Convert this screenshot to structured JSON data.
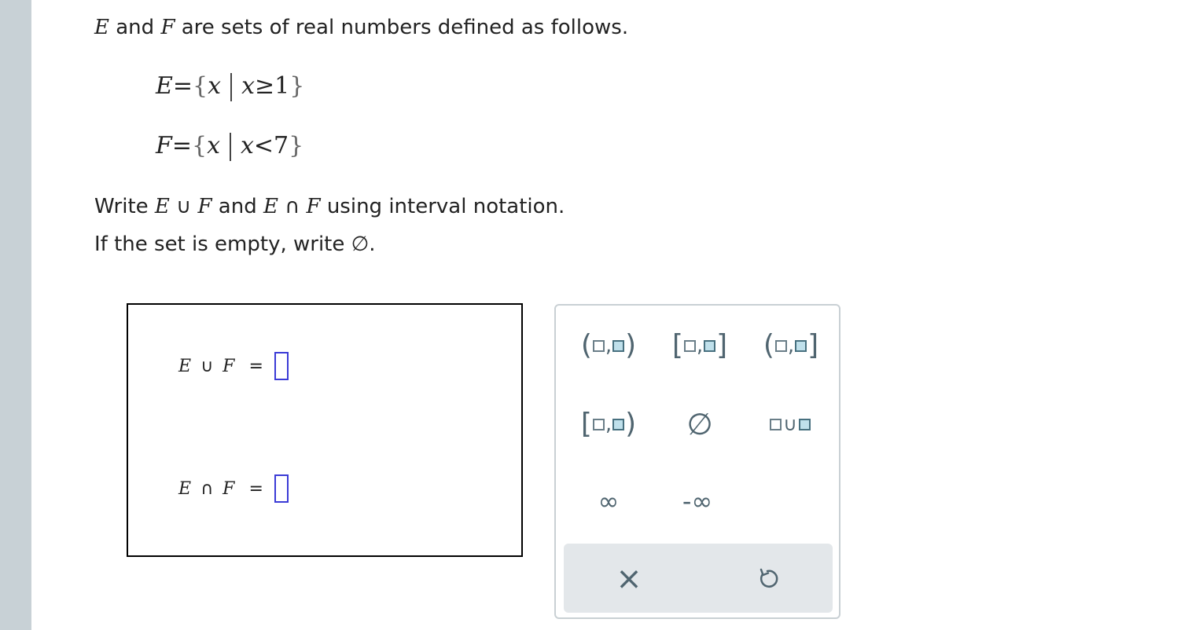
{
  "question": {
    "set_e": "E",
    "set_f": "F",
    "intro_and": "and",
    "intro_rest": "are sets of real numbers defined as follows.",
    "def_e": {
      "lhs": "E",
      "var": "x",
      "cond_var": "x",
      "cond_op": "≥",
      "cond_val": "1"
    },
    "def_f": {
      "lhs": "F",
      "var": "x",
      "cond_var": "x",
      "cond_op": "<",
      "cond_val": "7"
    },
    "instr_write": "Write",
    "union_symbol": "∪",
    "intersection_symbol": "∩",
    "instr_and": "and",
    "instr_rest": "using interval notation.",
    "empty_line": "If the set is empty, write",
    "empty_symbol": "∅",
    "period": "."
  },
  "answers": {
    "union_lhs_e": "E",
    "union_op": "∪",
    "union_lhs_f": "F",
    "inter_lhs_e": "E",
    "inter_op": "∩",
    "inter_lhs_f": "F",
    "equals": "="
  },
  "keypad": {
    "open_open_left": "(",
    "open_open_right": ")",
    "closed_closed_left": "[",
    "closed_closed_right": "]",
    "open_closed_left": "(",
    "open_closed_right": "]",
    "closed_open_left": "[",
    "closed_open_right": ")",
    "comma": ",",
    "empty_set": "∅",
    "union": "∪",
    "infinity": "∞",
    "neg_infinity": "-∞",
    "clear": "×",
    "undo_icon": "undo-icon"
  }
}
